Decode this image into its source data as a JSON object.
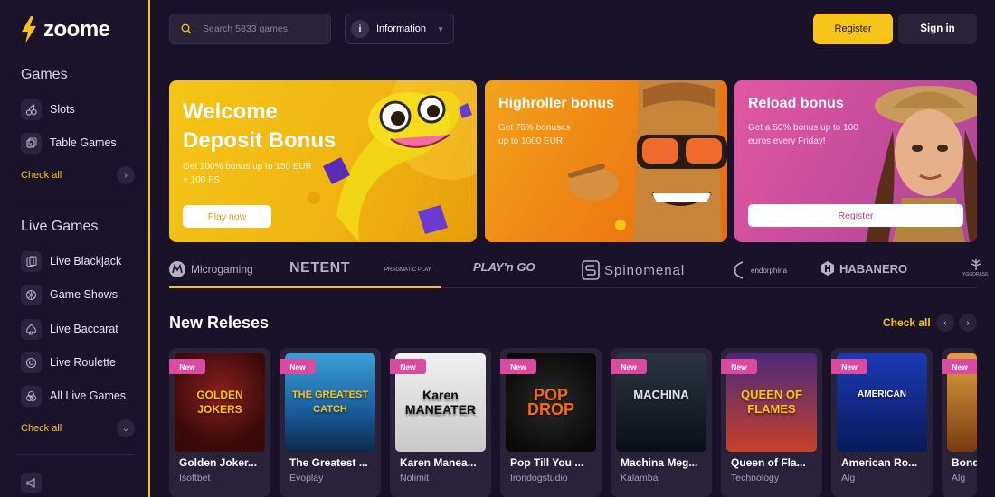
{
  "brand": {
    "name": "zoome",
    "accent": "#f5c518",
    "new_badge_color": "#d94b9e"
  },
  "sidebar": {
    "games_heading": "Games",
    "games": [
      {
        "label": "Slots",
        "icon": "cherry-icon"
      },
      {
        "label": "Table Games",
        "icon": "dice-icon"
      }
    ],
    "games_check_all": "Check all",
    "live_heading": "Live Games",
    "live": [
      {
        "label": "Live Blackjack",
        "icon": "cards-icon"
      },
      {
        "label": "Game Shows",
        "icon": "wheel-icon"
      },
      {
        "label": "Live Baccarat",
        "icon": "spade-icon"
      },
      {
        "label": "Live Roulette",
        "icon": "roulette-icon"
      },
      {
        "label": "All Live Games",
        "icon": "grid-icon"
      }
    ],
    "live_check_all": "Check all"
  },
  "header": {
    "search_placeholder": "Search 5833 games",
    "info_label": "Information",
    "register_label": "Register",
    "signin_label": "Sign in"
  },
  "banners": [
    {
      "title_line1": "Welcome",
      "title_line2": "Deposit Bonus",
      "desc_line1": "Get 100% bonus up to 150 EUR",
      "desc_line2": "+ 100 FS",
      "button": "Play now"
    },
    {
      "title": "Highroller bonus",
      "desc_line1": "Get 75% bonuses",
      "desc_line2": "up to 1000 EUR!"
    },
    {
      "title": "Reload bonus",
      "desc_line1": "Get a 50% bonus up to 100",
      "desc_line2": "euros every Friday!",
      "button": "Register"
    }
  ],
  "providers": [
    "Microgaming",
    "NETENT",
    "PRAGMATIC PLAY",
    "PLAY'n GO",
    "Spinomenal",
    "endorphina",
    "HABANERO",
    "YGGDRASIL"
  ],
  "releases": {
    "title": "New Releses",
    "check_all": "Check all",
    "badge": "New",
    "games": [
      {
        "title": "Golden Joker...",
        "provider": "Isoftbet",
        "art": "GOLDEN JOKERS"
      },
      {
        "title": "The Greatest ...",
        "provider": "Evoplay",
        "art": "THE GREATEST CATCH"
      },
      {
        "title": "Karen Manea...",
        "provider": "Nolimit",
        "art": "Karen MANEATER"
      },
      {
        "title": "Pop Till You ...",
        "provider": "Irondogstudio",
        "art": "POP DROP"
      },
      {
        "title": "Machina Meg...",
        "provider": "Kalamba",
        "art": "MACHINA"
      },
      {
        "title": "Queen of Fla...",
        "provider": "Technology",
        "art": "QUEEN OF FLAMES"
      },
      {
        "title": "American Ro...",
        "provider": "Alg",
        "art": "AMERICAN"
      },
      {
        "title": "Bond",
        "provider": "Alg",
        "art": ""
      }
    ]
  }
}
